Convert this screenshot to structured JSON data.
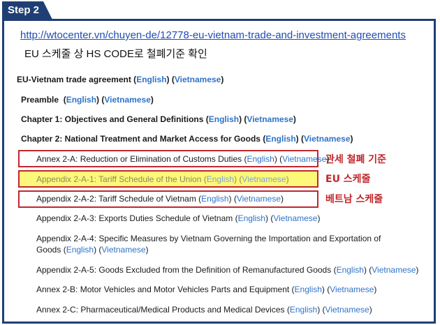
{
  "step_label": "Step 2",
  "url": "http://wtocenter.vn/chuyen-de/12778-eu-vietnam-trade-and-investment-agreements",
  "subtitle": "EU 스케줄 상 HS CODE로 철폐기준 확인",
  "links": {
    "en": "English",
    "vi": "Vietnamese"
  },
  "entries": {
    "agreement": "EU-Vietnam trade agreement",
    "preamble": "Preamble",
    "ch1": "Chapter 1: Objectives and General Definitions",
    "ch2": "Chapter 2: National Treatment and Market Access for Goods",
    "annex2a": "Annex 2-A: Reduction or Elimination of Customs Duties",
    "app2a1": "Appendix 2-A-1: Tariff Schedule of the Union",
    "app2a2": "Appendix 2-A-2: Tariff Schedule of Vietnam",
    "app2a3": "Appendix 2-A-3: Exports Duties Schedule of Vietnam",
    "app2a4_line1": "Appendix 2-A-4: Specific Measures by Vietnam Governing the Importation and Exportation of",
    "app2a4_line2": "Goods",
    "app2a5": "Appendix 2-A-5: Goods Excluded from the Definition of Remanufactured Goods",
    "annex2b": "Annex 2-B: Motor Vehicles and Motor Vehicles Parts and Equipment",
    "annex2c": "Annex 2-C: Pharmaceutical/Medical Products and Medical Devices"
  },
  "annotations": {
    "duty_elimination_criteria": "관세 철폐 기준",
    "eu_schedule": "EU 스케줄",
    "vietnam_schedule": "베트남 스케줄"
  },
  "colors": {
    "frame": "#1f3f74",
    "link": "#2f73c9",
    "highlight": "#fdf77a",
    "annotation": "#c0272d"
  }
}
